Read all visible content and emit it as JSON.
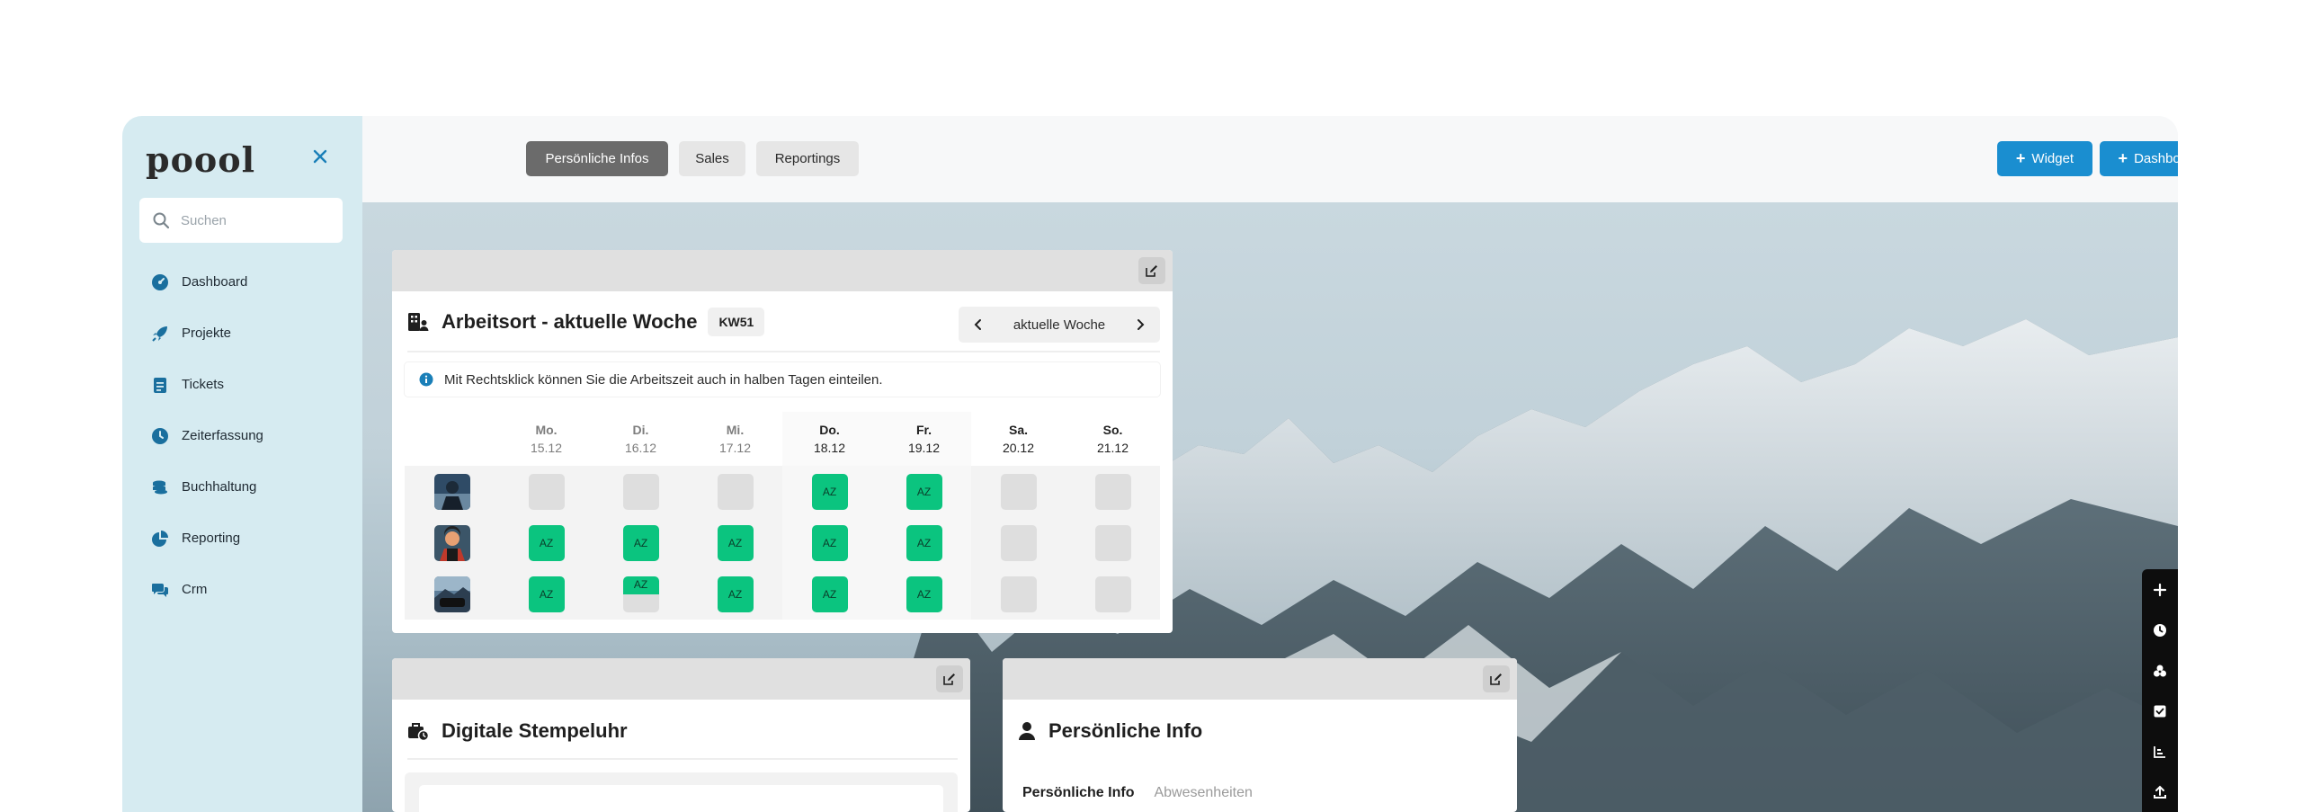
{
  "sidebar": {
    "logo": "poool",
    "search_placeholder": "Suchen",
    "items": [
      {
        "label": "Dashboard",
        "icon": "dashboard-gauge-icon"
      },
      {
        "label": "Projekte",
        "icon": "rocket-icon"
      },
      {
        "label": "Tickets",
        "icon": "clipboard-icon"
      },
      {
        "label": "Zeiterfassung",
        "icon": "clock-icon"
      },
      {
        "label": "Buchhaltung",
        "icon": "coins-icon"
      },
      {
        "label": "Reporting",
        "icon": "pie-chart-icon"
      },
      {
        "label": "Crm",
        "icon": "users-chat-icon"
      }
    ]
  },
  "topbar": {
    "tabs": [
      {
        "label": "Persönliche Infos",
        "active": true
      },
      {
        "label": "Sales",
        "active": false
      },
      {
        "label": "Reportings",
        "active": false
      }
    ],
    "add_widget": "Widget",
    "add_dashboard": "Dashboard"
  },
  "arbeitsort": {
    "title": "Arbeitsort - aktuelle Woche",
    "week_badge": "KW51",
    "week_label": "aktuelle Woche",
    "info_text": "Mit Rechtsklick können Sie die Arbeitszeit auch in halben Tagen einteilen.",
    "days": [
      {
        "day": "Mo.",
        "date": "15.12",
        "bold": false
      },
      {
        "day": "Di.",
        "date": "16.12",
        "bold": false
      },
      {
        "day": "Mi.",
        "date": "17.12",
        "bold": false
      },
      {
        "day": "Do.",
        "date": "18.12",
        "bold": true
      },
      {
        "day": "Fr.",
        "date": "19.12",
        "bold": true
      },
      {
        "day": "Sa.",
        "date": "20.12",
        "bold": true
      },
      {
        "day": "So.",
        "date": "21.12",
        "bold": true
      }
    ],
    "slot_label": "AZ",
    "rows": [
      [
        "",
        "",
        "",
        "AZ",
        "AZ",
        "",
        ""
      ],
      [
        "AZ",
        "AZ",
        "AZ",
        "AZ",
        "AZ",
        "",
        ""
      ],
      [
        "AZ",
        "AZ-half",
        "AZ",
        "AZ",
        "AZ",
        "",
        ""
      ]
    ]
  },
  "stempeluhr": {
    "title": "Digitale Stempeluhr"
  },
  "persoenlich": {
    "title": "Persönliche Info",
    "tabs": [
      "Persönliche Info",
      "Abwesenheiten"
    ]
  },
  "colors": {
    "accent": "#1a8ed0",
    "sidebar_bg": "#d6ebf1",
    "az_green": "#0bc47f",
    "toolbar_black": "#0d0d0d"
  }
}
